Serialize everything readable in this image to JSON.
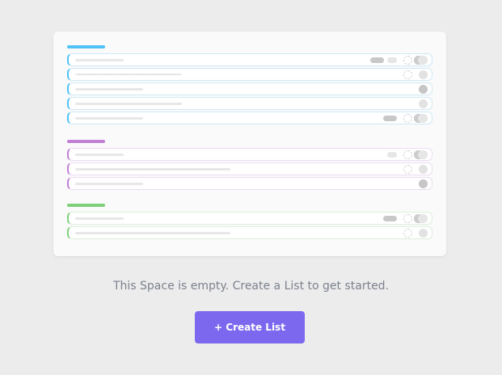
{
  "empty_state": {
    "message": "This Space is empty. Create a List to get started.",
    "button_label": "+ Create List"
  },
  "colors": {
    "background": "#ececec",
    "card": "#fafafa",
    "accent_button": "#7b68ee",
    "group_blue": "#4fc3f7",
    "group_purple": "#c17fd6",
    "group_green": "#7ed17a"
  },
  "illustration": {
    "groups": [
      {
        "name": "blue-group",
        "color": "#4fc3f7",
        "row_count": 5
      },
      {
        "name": "purple-group",
        "color": "#c17fd6",
        "row_count": 3
      },
      {
        "name": "green-group",
        "color": "#7ed17a",
        "row_count": 2
      }
    ]
  }
}
